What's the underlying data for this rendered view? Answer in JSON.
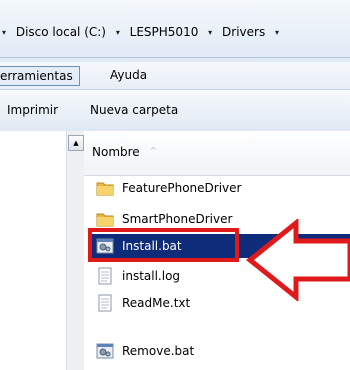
{
  "breadcrumb": {
    "items": [
      "Disco local (C:)",
      "LESPH5010",
      "Drivers"
    ],
    "separator": "▾"
  },
  "menubar": {
    "items": [
      "erramientas",
      "Ayuda"
    ]
  },
  "toolbar": {
    "items": [
      "Imprimir",
      "Nueva carpeta"
    ]
  },
  "file_list": {
    "column_header": "Nombre",
    "sort_indicator": "^",
    "selected_index": 2,
    "files": [
      {
        "name": "FeaturePhoneDriver",
        "icon": "folder-icon"
      },
      {
        "name": "SmartPhoneDriver",
        "icon": "folder-icon"
      },
      {
        "name": "Install.bat",
        "icon": "batch-file-icon"
      },
      {
        "name": "install.log",
        "icon": "text-file-icon"
      },
      {
        "name": "ReadMe.txt",
        "icon": "text-file-icon"
      },
      {
        "name": "Remove.bat",
        "icon": "batch-file-icon"
      }
    ]
  },
  "annotation": {
    "color": "#e0191b"
  },
  "colors": {
    "selection": "#0f2c7a",
    "folder": "#e9b73d"
  }
}
